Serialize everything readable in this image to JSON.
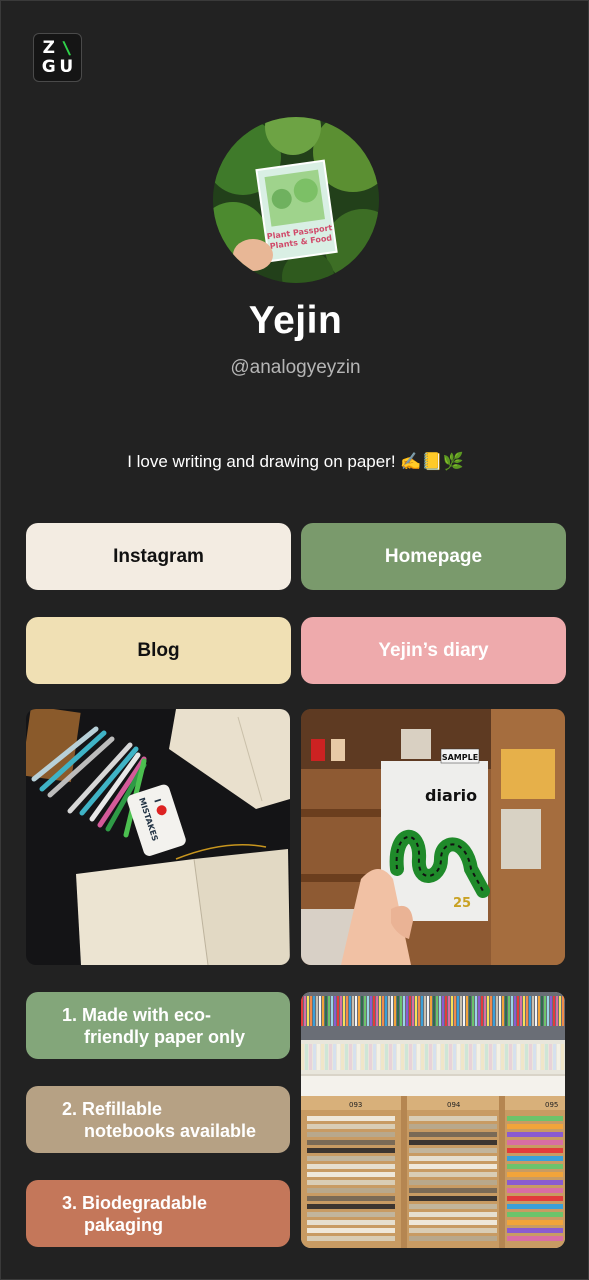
{
  "logo": {
    "letters": [
      "Z",
      "\\",
      "G",
      "U"
    ]
  },
  "profile": {
    "name": "Yejin",
    "handle": "@analogyeyzin",
    "bio": "I love writing and drawing on paper! ✍️📒🌿",
    "avatar_card_text_1": "Plant Passport",
    "avatar_card_text_2": "Plants & Food"
  },
  "links": [
    {
      "label": "Instagram",
      "bg": "#f3ece2",
      "fg": "#111111"
    },
    {
      "label": "Homepage",
      "bg": "#7a9a6c",
      "fg": "#ffffff"
    },
    {
      "label": "Blog",
      "bg": "#f0e0b4",
      "fg": "#111111"
    },
    {
      "label": "Yejin’s diary",
      "bg": "#eeaaac",
      "fg": "#ffffff"
    }
  ],
  "photos": {
    "pens": {
      "eraser_text_1": "I",
      "eraser_text_2": "MISTAKES"
    },
    "diario": {
      "sample_label": "SAMPLE",
      "title": "diario",
      "year": "25"
    },
    "shelf": {
      "labels": [
        "093",
        "094",
        "095"
      ]
    }
  },
  "features": [
    {
      "num": "1.",
      "line1": "Made with eco-",
      "line2": "friendly paper only",
      "bg": "#83a67a"
    },
    {
      "num": "2.",
      "line1": "Refillable",
      "line2": "notebooks available",
      "bg": "#b6a184"
    },
    {
      "num": "3.",
      "line1": "Biodegradable",
      "line2": "pakaging",
      "bg": "#c4775a"
    }
  ]
}
